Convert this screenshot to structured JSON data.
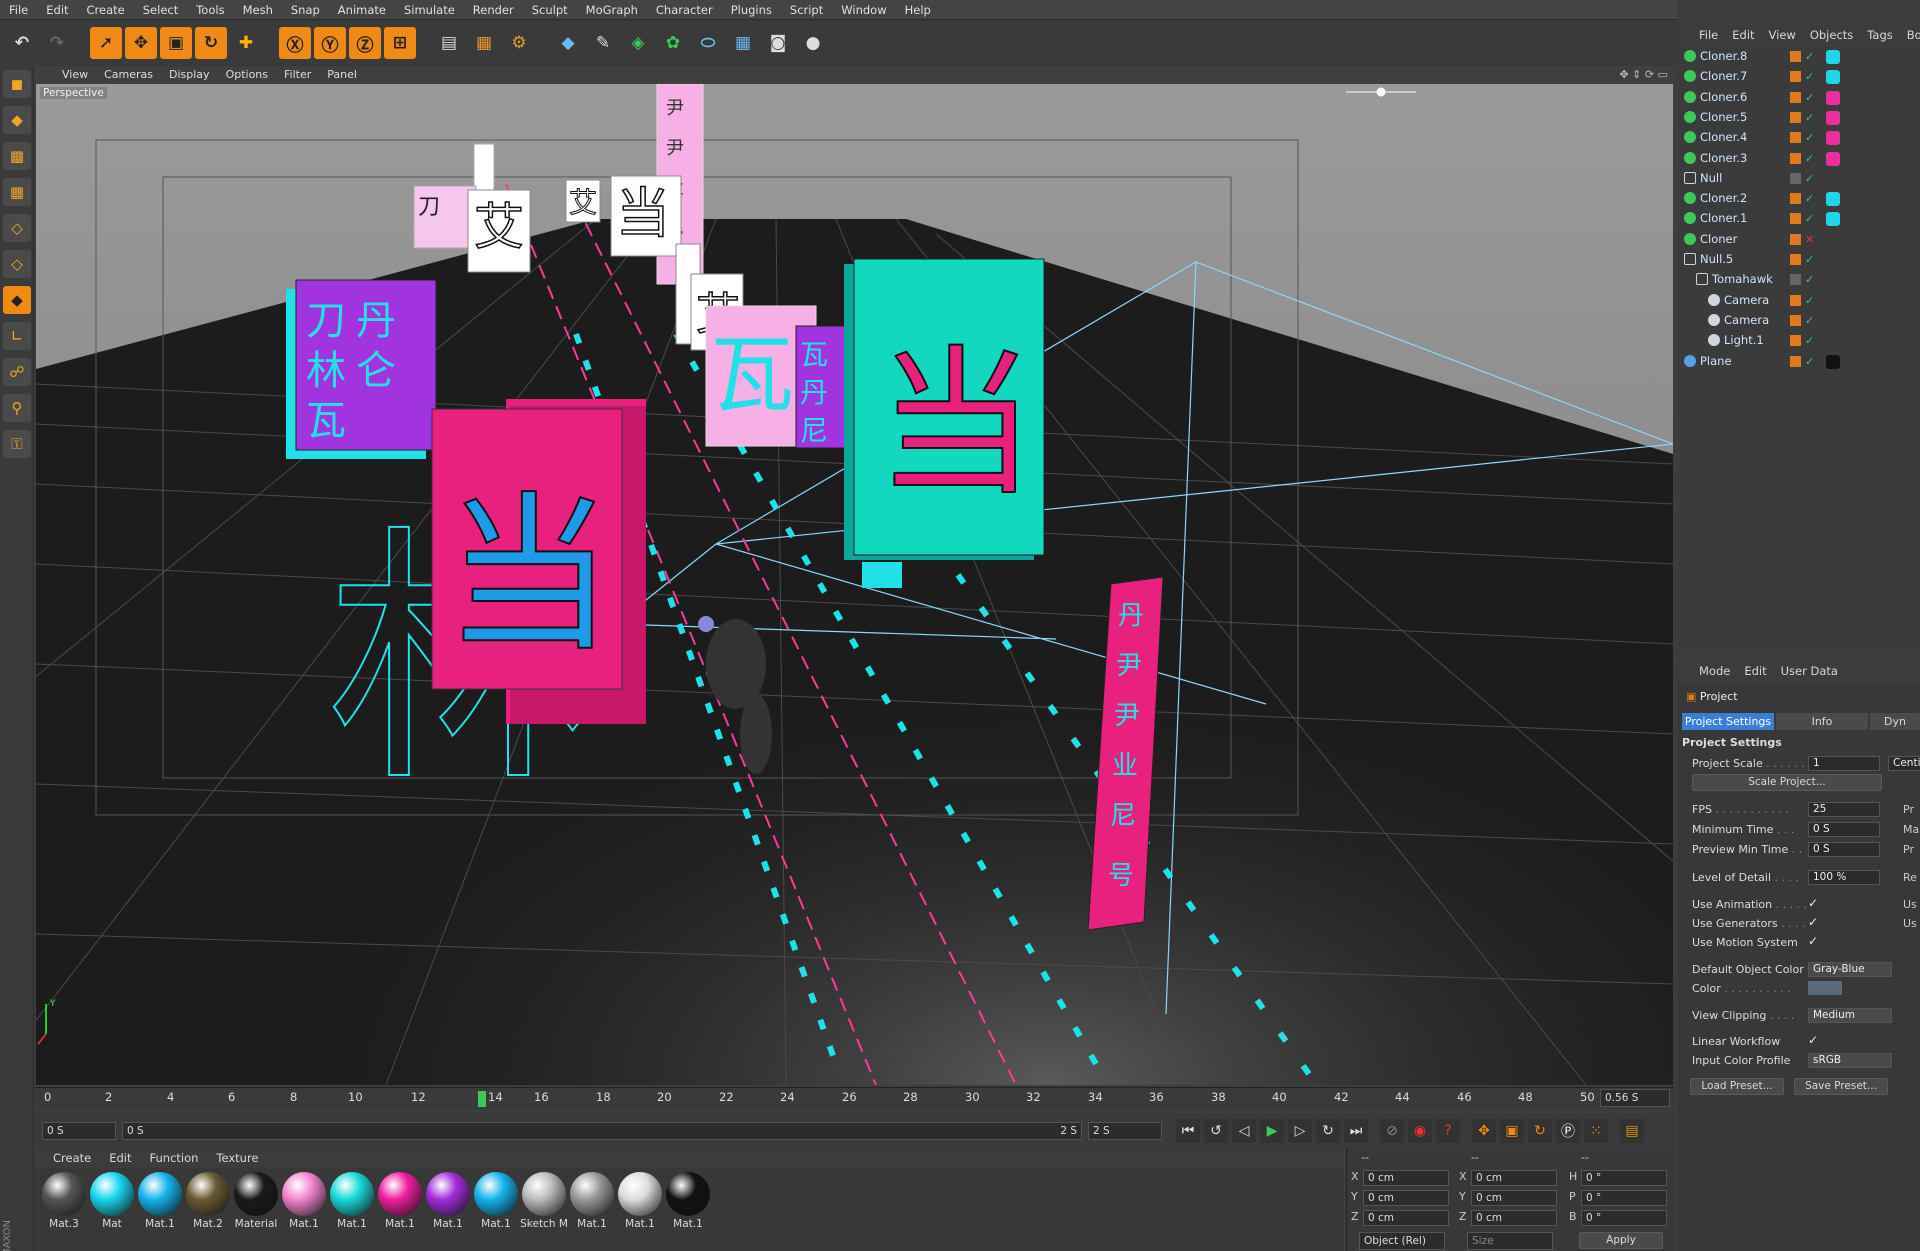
{
  "menu": [
    "File",
    "Edit",
    "Create",
    "Select",
    "Tools",
    "Mesh",
    "Snap",
    "Animate",
    "Simulate",
    "Render",
    "Sculpt",
    "MoGraph",
    "Character",
    "Plugins",
    "Script",
    "Window",
    "Help"
  ],
  "viewport": {
    "menu": [
      "View",
      "Cameras",
      "Display",
      "Options",
      "Filter",
      "Panel"
    ],
    "label": "Perspective"
  },
  "timeline": {
    "ticks": [
      "0",
      "2",
      "4",
      "6",
      "8",
      "10",
      "12",
      "14",
      "16",
      "18",
      "20",
      "22",
      "24",
      "26",
      "28",
      "30",
      "32",
      "34",
      "36",
      "38",
      "40",
      "42",
      "44",
      "46",
      "48",
      "50"
    ],
    "current": "0.56 S",
    "start": "0 S",
    "range_start": "0 S",
    "range_end": "2 S",
    "end": "2 S"
  },
  "material_menu": [
    "Create",
    "Edit",
    "Function",
    "Texture"
  ],
  "materials": [
    {
      "name": "Mat.3",
      "color": "#555555"
    },
    {
      "name": "Mat",
      "color": "#17d6ee"
    },
    {
      "name": "Mat.1",
      "color": "#16b2ee"
    },
    {
      "name": "Mat.2",
      "color": "#6a5a33"
    },
    {
      "name": "Material",
      "color": "#1a1a1a"
    },
    {
      "name": "Mat.1",
      "color": "#f485d0"
    },
    {
      "name": "Mat.1",
      "color": "#19d9d9"
    },
    {
      "name": "Mat.1",
      "color": "#ee1e9e"
    },
    {
      "name": "Mat.1",
      "color": "#a12ddb"
    },
    {
      "name": "Mat.1",
      "color": "#16b2ee"
    },
    {
      "name": "Sketch M",
      "color": "#bbbbbb"
    },
    {
      "name": "Mat.1",
      "color": "#999999"
    },
    {
      "name": "Mat.1",
      "color": "#dddddd"
    },
    {
      "name": "Mat.1",
      "color": "#111111"
    }
  ],
  "coords": {
    "header": [
      "--",
      "--",
      "--"
    ],
    "rows": [
      {
        "a": "X",
        "v1": "0 cm",
        "b": "X",
        "v2": "0 cm",
        "c": "H",
        "v3": "0 °"
      },
      {
        "a": "Y",
        "v1": "0 cm",
        "b": "Y",
        "v2": "0 cm",
        "c": "P",
        "v3": "0 °"
      },
      {
        "a": "Z",
        "v1": "0 cm",
        "b": "Z",
        "v2": "0 cm",
        "c": "B",
        "v3": "0 °"
      }
    ],
    "mode": "Object (Rel)",
    "size": "Size",
    "apply": "Apply"
  },
  "objects_menu": [
    "File",
    "Edit",
    "View",
    "Objects",
    "Tags",
    "Boo"
  ],
  "objects": [
    {
      "name": "Cloner.8",
      "indent": 0,
      "tag": "#1fd6e8"
    },
    {
      "name": "Cloner.7",
      "indent": 0,
      "tag": "#1fd6e8"
    },
    {
      "name": "Cloner.6",
      "indent": 0,
      "tag": "#ef2d9c"
    },
    {
      "name": "Cloner.5",
      "indent": 0,
      "tag": "#ef2d9c"
    },
    {
      "name": "Cloner.4",
      "indent": 0,
      "tag": "#ef2d9c"
    },
    {
      "name": "Cloner.3",
      "indent": 0,
      "tag": "#ef2d9c"
    },
    {
      "name": "Null",
      "indent": 0,
      "tag": ""
    },
    {
      "name": "Cloner.2",
      "indent": 0,
      "tag": "#1fd6e8"
    },
    {
      "name": "Cloner.1",
      "indent": 0,
      "tag": "#1fd6e8"
    },
    {
      "name": "Cloner",
      "indent": 0,
      "tag": ""
    },
    {
      "name": "Null.5",
      "indent": 0,
      "tag": ""
    },
    {
      "name": "Tomahawk",
      "indent": 1,
      "tag": ""
    },
    {
      "name": "Camera",
      "indent": 2,
      "tag": ""
    },
    {
      "name": "Camera",
      "indent": 2,
      "tag": ""
    },
    {
      "name": "Light.1",
      "indent": 2,
      "tag": ""
    },
    {
      "name": "Plane",
      "indent": 0,
      "tag": "#111111"
    }
  ],
  "attr_menu": [
    "Mode",
    "Edit",
    "User Data"
  ],
  "attr": {
    "title": "Project",
    "tabs": [
      "Project Settings",
      "Info",
      "Dyn"
    ],
    "section": "Project Settings",
    "project_scale_label": "Project Scale",
    "project_scale": "1",
    "project_scale_unit": "Centi",
    "scale_btn": "Scale Project...",
    "fps_label": "FPS",
    "fps": "25",
    "min_time_label": "Minimum Time",
    "min_time": "0 S",
    "preview_min_label": "Preview Min Time",
    "preview_min": "0 S",
    "lod_label": "Level of Detail",
    "lod": "100 %",
    "use_anim": "Use Animation",
    "use_gen": "Use Generators",
    "use_motion": "Use Motion System",
    "def_color_label": "Default Object Color",
    "def_color": "Gray-Blue",
    "color_label": "Color",
    "clip_label": "View Clipping",
    "clip": "Medium",
    "linear_label": "Linear Workflow",
    "input_profile_label": "Input Color Profile",
    "input_profile": "sRGB",
    "load_preset": "Load Preset...",
    "save_preset": "Save Preset...",
    "right_cut": [
      "Pr",
      "Ma",
      "Pr",
      "Re",
      "Us",
      "Us"
    ]
  },
  "scene_glyphs": [
    "刀",
    "丹",
    "林",
    "仑",
    "瓦",
    "艾",
    "当",
    "尹",
    "业",
    "尼",
    "号"
  ],
  "colors": {
    "cyan": "#22e0e8",
    "magenta": "#e8207e",
    "purple": "#a234e0",
    "pink": "#f7b0e6",
    "teal": "#12d8c0",
    "blue": "#1e9ae6"
  }
}
